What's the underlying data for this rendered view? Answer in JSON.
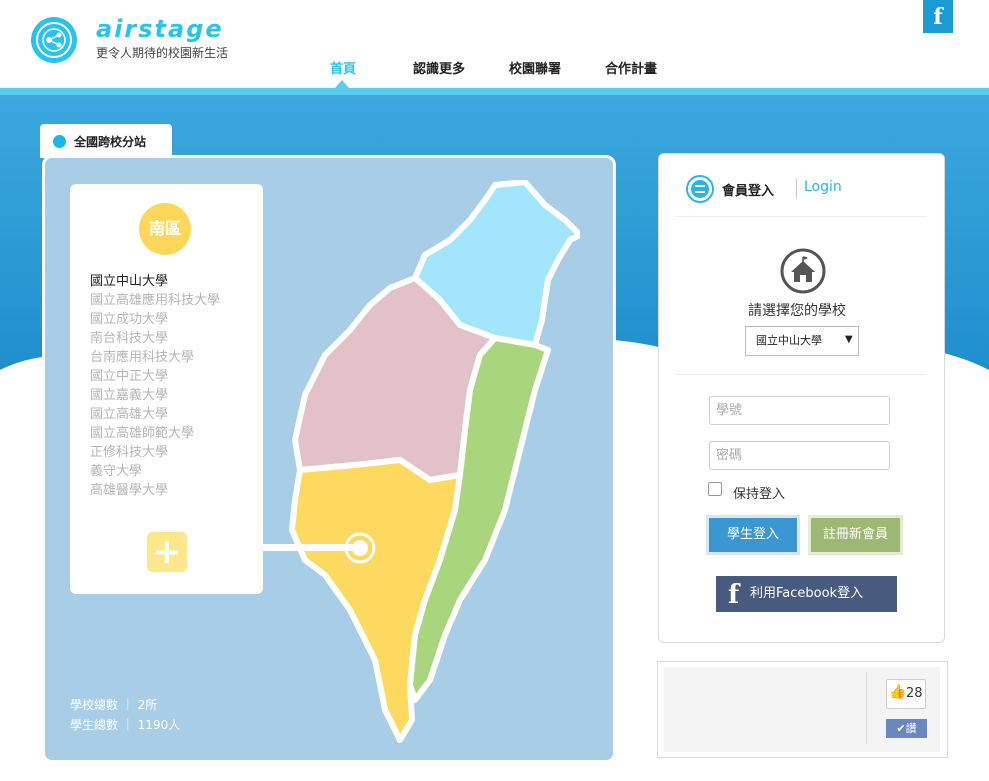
{
  "header": {
    "logo_word": "airstage",
    "tagline": "更令人期待的校園新生活",
    "nav": [
      "首頁",
      "認識更多",
      "校園聯署",
      "合作計畫"
    ],
    "active_nav": "首頁",
    "facebook_icon": "f"
  },
  "map_panel": {
    "tab_label": "全國跨校分站",
    "region": "南區",
    "schools": [
      "國立中山大學",
      "國立高雄應用科技大學",
      "國立成功大學",
      "南台科技大學",
      "台南應用科技大學",
      "國立中正大學",
      "國立嘉義大學",
      "國立高雄大學",
      "國立高雄師範大學",
      "正修科技大學",
      "義守大學",
      "高雄醫學大學"
    ],
    "selected_school_index": 0,
    "add_button_icon": "+",
    "stats": {
      "schools_label": "學校總數",
      "schools_value": "2所",
      "students_label": "學生總數",
      "students_value": "1190人"
    },
    "region_colors": {
      "north": "#a3e6fb",
      "central": "#e2c2c8",
      "south": "#fed960",
      "east": "#a9d57c"
    }
  },
  "login": {
    "title": "會員登入",
    "title_en": "Login",
    "choose_school": "請選擇您的學校",
    "selected_school": "國立中山大學",
    "student_id_placeholder": "學號",
    "password_placeholder": "密碼",
    "remember": "保持登入",
    "student_login": "學生登入",
    "register": "註冊新會員",
    "facebook_login": "利用Facebook登入",
    "facebook_icon": "f"
  },
  "like": {
    "count": "28",
    "button": "✔讚"
  },
  "colors": {
    "accent": "#29c4ee",
    "sky": "#1f8fcd",
    "login_btn": "#3a97d2",
    "register_btn": "#9db873",
    "facebook": "#485a7d"
  }
}
